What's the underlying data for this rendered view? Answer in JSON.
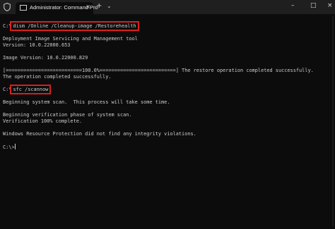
{
  "titlebar": {
    "tab_title": "Administrator: Command Pro",
    "tab_close": "×",
    "new_tab": "+",
    "dropdown": "⌄",
    "minimize": "–",
    "maximize": "□",
    "close": "×"
  },
  "console": {
    "prompt1_prefix": "C:\\",
    "prompt1_command": "dism /Online /Cleanup-image /Restorehealth",
    "line_tool": "Deployment Image Servicing and Management tool",
    "line_version": "Version: 10.0.22000.653",
    "line_image_version": "Image Version: 10.0.22000.829",
    "line_progress": "[==========================100.0%==========================] The restore operation completed successfully.",
    "line_completed": "The operation completed successfully.",
    "prompt2_prefix": "C:\\",
    "prompt2_command": "sfc /scannow",
    "line_begin_scan": "Beginning system scan.  This process will take some time.",
    "line_begin_verify": "Beginning verification phase of system scan.",
    "line_verify_complete": "Verification 100% complete.",
    "line_result": "Windows Resource Protection did not find any integrity violations.",
    "prompt3": "C:\\>"
  },
  "colors": {
    "highlight_box": "#d9201f",
    "terminal_text": "#cccccc",
    "terminal_bg": "#0c0c0c"
  }
}
